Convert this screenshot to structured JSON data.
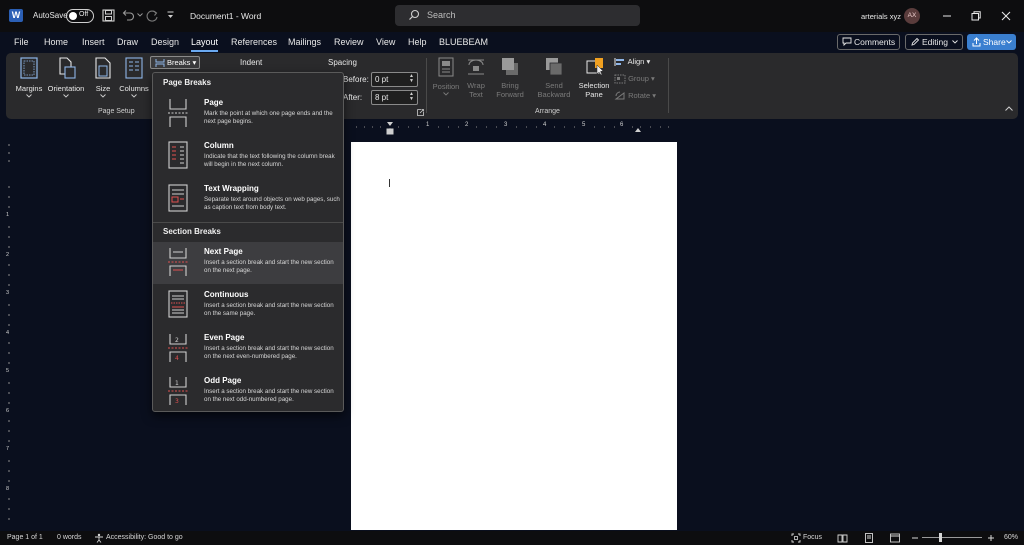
{
  "titlebar": {
    "app_letter": "W",
    "autosave_label": "AutoSave",
    "autosave_state": "Off",
    "doc_title": "Document1  -  Word",
    "search_placeholder": "Search",
    "user_name": "arterials xyz",
    "avatar_initials": "AX"
  },
  "menu": {
    "tabs": [
      "File",
      "Home",
      "Insert",
      "Draw",
      "Design",
      "Layout",
      "References",
      "Mailings",
      "Review",
      "View",
      "Help",
      "BLUEBEAM"
    ],
    "active_tab": "Layout",
    "comments_label": "Comments",
    "editing_label": "Editing",
    "share_label": "Share"
  },
  "ribbon": {
    "page_setup": {
      "margins": "Margins",
      "orientation": "Orientation",
      "size": "Size",
      "columns": "Columns",
      "breaks": "Breaks",
      "group_label": "Page Setup"
    },
    "paragraph": {
      "indent_label": "Indent",
      "spacing_label": "Spacing",
      "before_label": "Before:",
      "before_value": "0 pt",
      "after_label": "After:",
      "after_value": "8 pt"
    },
    "arrange": {
      "position": "Position",
      "wrap_text_1": "Wrap",
      "wrap_text_2": "Text",
      "bring_forward_1": "Bring",
      "bring_forward_2": "Forward",
      "send_backward_1": "Send",
      "send_backward_2": "Backward",
      "selection_pane_1": "Selection",
      "selection_pane_2": "Pane",
      "align": "Align",
      "group": "Group",
      "rotate": "Rotate",
      "group_label": "Arrange"
    }
  },
  "breaks_menu": {
    "page_breaks_header": "Page Breaks",
    "section_breaks_header": "Section Breaks",
    "items": [
      {
        "title": "Page",
        "desc": "Mark the point at which one page ends and the next page begins."
      },
      {
        "title": "Column",
        "desc": "Indicate that the text following the column break will begin in the next column."
      },
      {
        "title": "Text Wrapping",
        "desc": "Separate text around objects on web pages, such as caption text from body text."
      },
      {
        "title": "Next Page",
        "desc": "Insert a section break and start the new section on the next page."
      },
      {
        "title": "Continuous",
        "desc": "Insert a section break and start the new section on the same page."
      },
      {
        "title": "Even Page",
        "desc": "Insert a section break and start the new section on the next even-numbered page."
      },
      {
        "title": "Odd Page",
        "desc": "Insert a section break and start the new section on the next odd-numbered page."
      }
    ],
    "highlighted_item": "Next Page"
  },
  "ruler": {
    "h_numbers": [
      "1",
      "2",
      "3",
      "4",
      "5",
      "6"
    ],
    "v_numbers": [
      "1",
      "2",
      "3",
      "4",
      "5",
      "6",
      "7",
      "8"
    ]
  },
  "statusbar": {
    "page_info": "Page 1 of 1",
    "words": "0 words",
    "accessibility": "Accessibility: Good to go",
    "focus": "Focus",
    "zoom": "60%"
  },
  "colors": {
    "accent": "#3a7fd0",
    "tab_underline": "#6aa9f0",
    "icon_red": "#e05050",
    "selection_pane_icon": "#f0a020"
  }
}
